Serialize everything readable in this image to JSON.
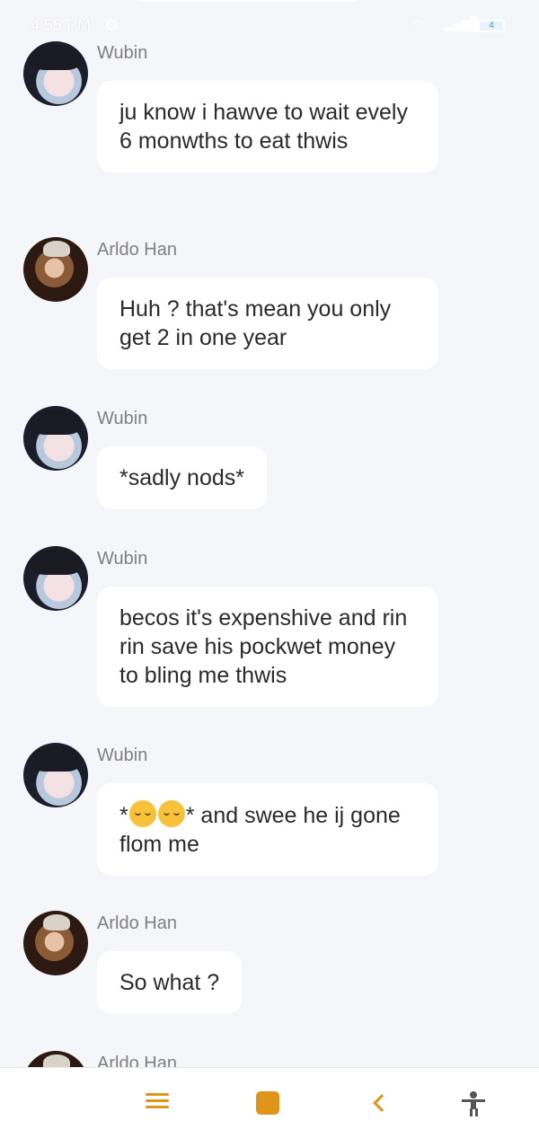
{
  "status_bar": {
    "time": "4:55 PM",
    "battery": "4"
  },
  "messages": [
    {
      "sender": "Wubin",
      "text": "ju know i hawve to wait evely 6 monwths to eat thwis"
    },
    {
      "sender": "Arldo Han",
      "text": "Huh ? that's mean you only get 2 in one year"
    },
    {
      "sender": "Wubin",
      "text": "*sadly nods*"
    },
    {
      "sender": "Wubin",
      "text": "becos it's expenshive and rin rin save his pockwet money to bling me thwis"
    },
    {
      "sender": "Wubin",
      "text_before": "*",
      "emoji": [
        "pensive-face",
        "pensive-face"
      ],
      "text_after": "* and swee he ij gone flom me"
    },
    {
      "sender": "Arldo Han",
      "text": "So what ?"
    },
    {
      "sender": "Arldo Han",
      "text": ""
    }
  ],
  "bottom_nav": {
    "accent_color": "#e0951a",
    "icons": [
      "menu-icon",
      "home-icon",
      "back-icon",
      "accessibility-icon"
    ]
  }
}
